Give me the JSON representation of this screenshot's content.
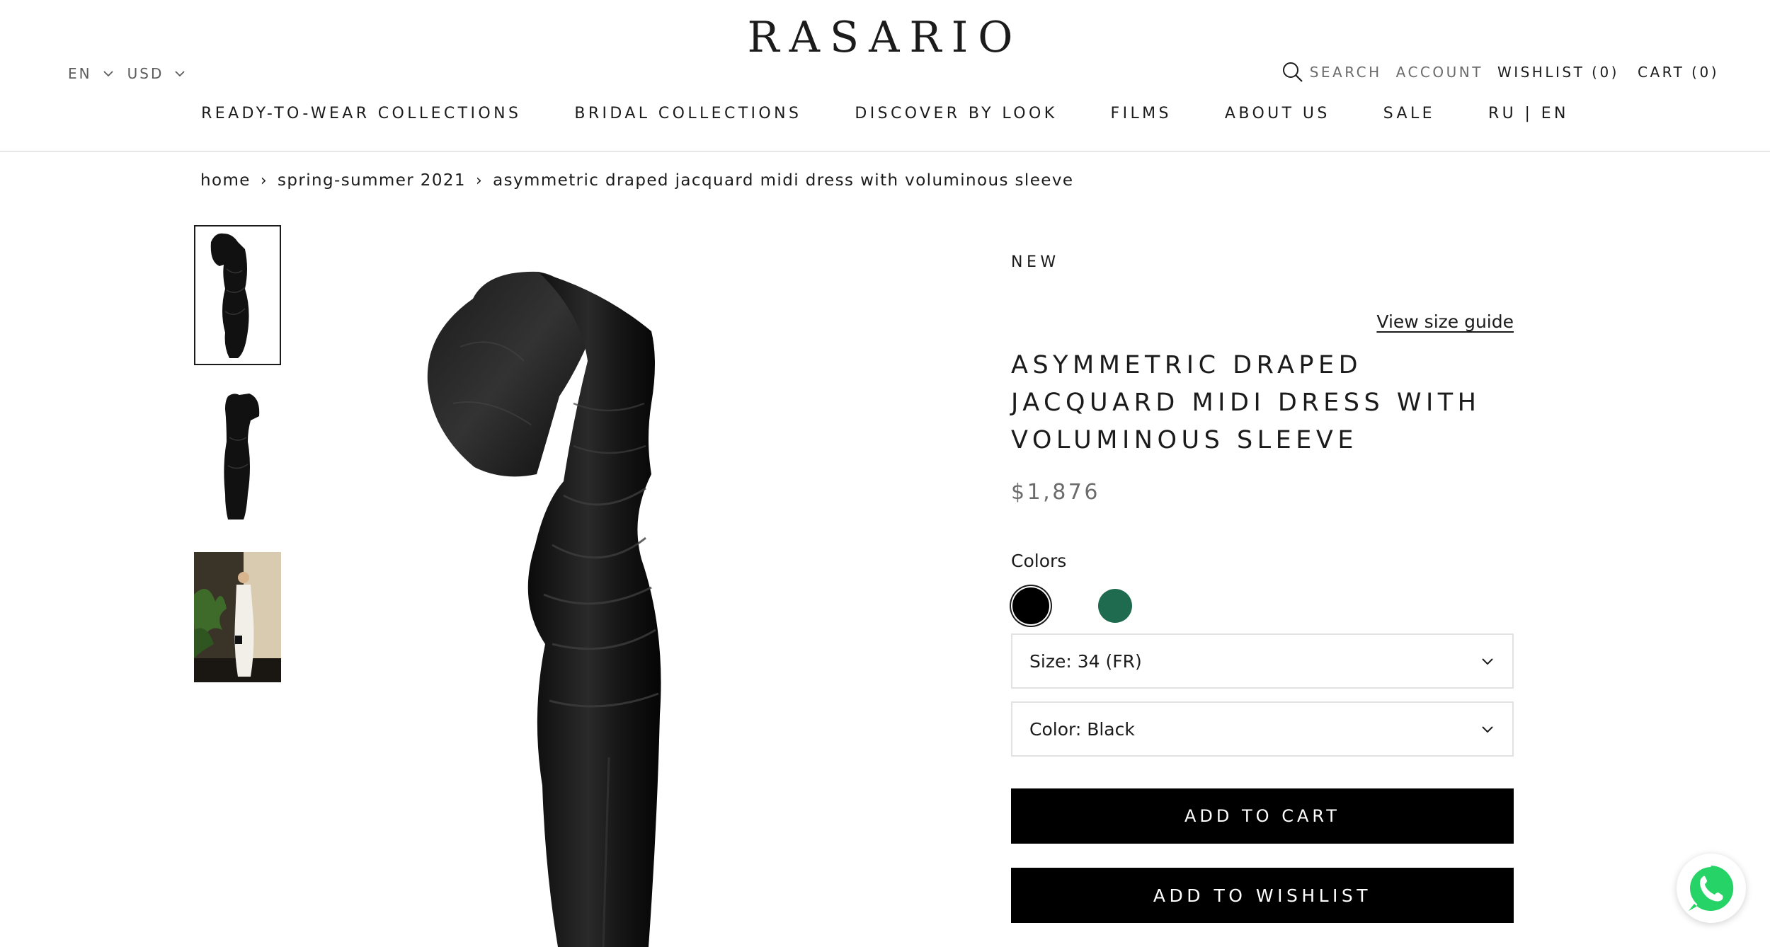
{
  "header": {
    "logo": "RASARIO",
    "language": "EN",
    "currency": "USD",
    "search_label": "SEARCH",
    "account_label": "ACCOUNT",
    "wishlist_label": "WISHLIST (0)",
    "cart_label": "CART (0)"
  },
  "nav": {
    "items": [
      {
        "label": "READY-TO-WEAR COLLECTIONS"
      },
      {
        "label": "BRIDAL COLLECTIONS"
      },
      {
        "label": "DISCOVER BY LOOK"
      },
      {
        "label": "FILMS"
      },
      {
        "label": "ABOUT US"
      },
      {
        "label": "SALE"
      },
      {
        "label": "RU | EN"
      }
    ]
  },
  "breadcrumb": {
    "items": [
      {
        "label": "home"
      },
      {
        "label": "spring-summer 2021"
      },
      {
        "label": "asymmetric draped jacquard midi dress with voluminous sleeve"
      }
    ],
    "separator": "›"
  },
  "product": {
    "badge": "NEW",
    "size_guide": "View size guide",
    "title": "ASYMMETRIC DRAPED JACQUARD MIDI DRESS WITH VOLUMINOUS SLEEVE",
    "price": "$1,876",
    "colors_label": "Colors",
    "swatches": [
      {
        "name": "Black",
        "color": "#000000",
        "selected": true
      },
      {
        "name": "Green",
        "color": "#1f6b4f",
        "selected": false
      }
    ],
    "size_select": "Size: 34 (FR)",
    "color_select": "Color: Black",
    "add_to_cart": "ADD TO CART",
    "add_to_wishlist": "ADD TO WISHLIST"
  },
  "icons": {
    "search": "search-icon",
    "chevron": "chevron-down-icon",
    "whatsapp": "whatsapp-icon"
  },
  "colors": {
    "text": "#1c1b1b",
    "muted": "#6b6b6b",
    "button": "#000000",
    "whatsapp": "#25d366"
  }
}
